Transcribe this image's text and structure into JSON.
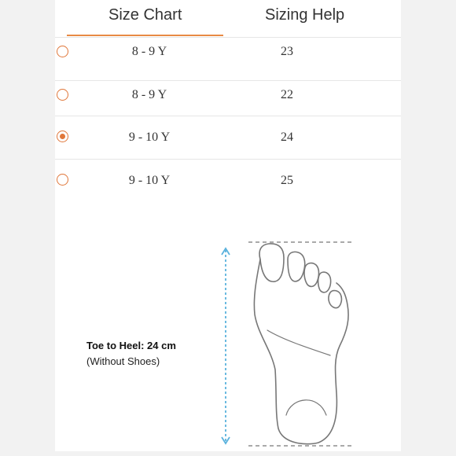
{
  "tabs": [
    {
      "label": "Size Chart",
      "active": true
    },
    {
      "label": "Sizing Help",
      "active": false
    }
  ],
  "rows": [
    {
      "size": "8 - 9 Y",
      "length": "23",
      "selected": false
    },
    {
      "size": "8 - 9 Y",
      "length": "22",
      "selected": false
    },
    {
      "size": "9 - 10 Y",
      "length": "24",
      "selected": true
    },
    {
      "size": "9 - 10 Y",
      "length": "25",
      "selected": false
    }
  ],
  "measurement": {
    "label": "Toe to Heel: 24 cm",
    "note": "(Without Shoes)"
  },
  "colors": {
    "accent": "#e0773a",
    "arrow": "#5bb2dd",
    "divider": "#e6e6e6"
  }
}
